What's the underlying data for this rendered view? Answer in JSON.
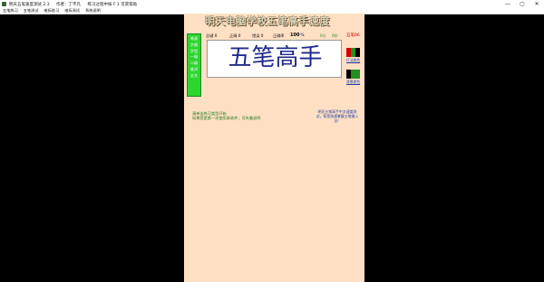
{
  "window": {
    "title_segments": [
      "明天五笔速度测试 2.3",
      "作者：丁不凡",
      "练习过程中按 F 1 可获帮助"
    ],
    "controls": {
      "minimize": "—",
      "maximize": "▢",
      "close": "✕"
    }
  },
  "menu": [
    "五笔练习",
    "五笔测试",
    "难拆练习",
    "难拆测试",
    "系统说明"
  ],
  "panel": {
    "header_title": "明天电脑学校五笔高手速度",
    "stats": [
      {
        "label": "总键",
        "value": "0"
      },
      {
        "label": "正确",
        "value": "0"
      },
      {
        "label": "错误",
        "value": "0"
      },
      {
        "label": "正确率",
        "value": "100"
      }
    ],
    "percent_symbol": "%",
    "mini_labels": [
      "0分",
      "0秒"
    ],
    "brand_text": "五笔86",
    "side_menu": [
      "笔画",
      "字根",
      "字型",
      "一级",
      "二级",
      "难词",
      "全文"
    ],
    "display_text": "五笔高手",
    "swatch_top_label": "打法颜色",
    "swatch_bottom_label": "背景颜色",
    "hint_line1": "请单击练习类型开始",
    "hint_line2": "如果您是第一次使用本软件，可先看说明",
    "right_note": "明天五笔高手中文速度测试，帮您快速掌握五笔输入法！"
  },
  "colors": {
    "panel_bg": "#ffe0c4",
    "side_menu_bg": "#2fd52f",
    "display_text": "#202a8c",
    "hint_text": "#1a7a1a",
    "link_text": "#1a3aaa",
    "swatches_top": [
      "#d40000",
      "#209020",
      "#000000",
      "#d40000",
      "#209020",
      "#000000"
    ],
    "swatches_bottom": [
      "#000000",
      "#209020",
      "#209020",
      "#000000",
      "#209020",
      "#209020"
    ]
  }
}
